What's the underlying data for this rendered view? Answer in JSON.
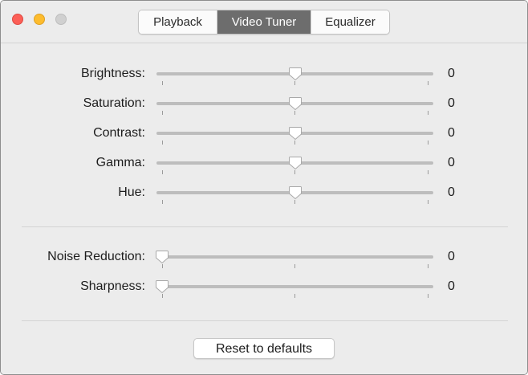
{
  "window": {
    "controls": {
      "close": "close-button",
      "minimize": "minimize-button",
      "zoom": "zoom-button"
    },
    "colors": {
      "close": "#fc5f57",
      "minimize": "#fdbc2e",
      "zoom": "#d0d0d0",
      "selected_tab": "#6d6d6d"
    }
  },
  "tabs": [
    {
      "label": "Playback",
      "selected": false
    },
    {
      "label": "Video Tuner",
      "selected": true
    },
    {
      "label": "Equalizer",
      "selected": false
    }
  ],
  "sliders_group1": [
    {
      "label": "Brightness:",
      "value": "0",
      "position": 0.5
    },
    {
      "label": "Saturation:",
      "value": "0",
      "position": 0.5
    },
    {
      "label": "Contrast:",
      "value": "0",
      "position": 0.5
    },
    {
      "label": "Gamma:",
      "value": "0",
      "position": 0.5
    },
    {
      "label": "Hue:",
      "value": "0",
      "position": 0.5
    }
  ],
  "sliders_group2": [
    {
      "label": "Noise Reduction:",
      "value": "0",
      "position": 0.0
    },
    {
      "label": "Sharpness:",
      "value": "0",
      "position": 0.0
    }
  ],
  "reset_button": {
    "label": "Reset to defaults"
  }
}
